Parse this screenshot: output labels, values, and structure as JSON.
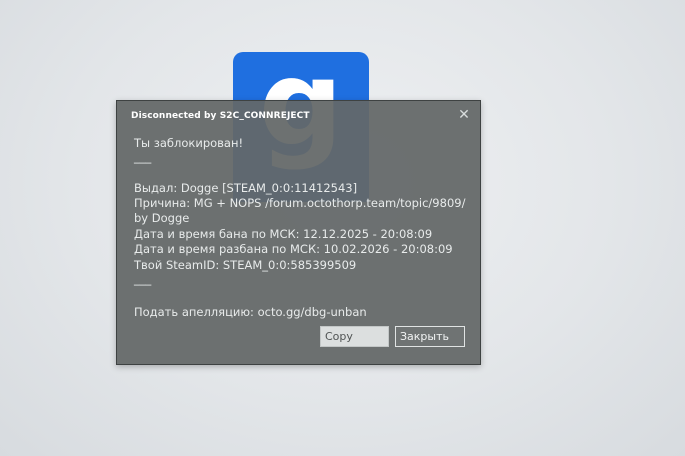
{
  "background": {
    "logo_letter": "g",
    "logo_color": "#1f6fe0"
  },
  "dialog": {
    "title": "Disconnected by S2C_CONNREJECT",
    "close_icon": "close-icon",
    "lines": [
      "Ты заблокирован!",
      "___",
      "Выдал: Dogge [STEAM_0:0:11412543]",
      "Причина: MG + NOPS /forum.octothorp.team/topic/9809/",
      "by Dogge",
      "Дата и время бана по МСК: 12.12.2025 - 20:08:09",
      "Дата и время разбана по МСК: 10.02.2026 - 20:08:09",
      "Твой SteamID: STEAM_0:0:585399509",
      "___",
      "Подать апелляцию: octo.gg/dbg-unban"
    ],
    "buttons": {
      "copy": "Copy",
      "close": "Закрыть"
    }
  }
}
